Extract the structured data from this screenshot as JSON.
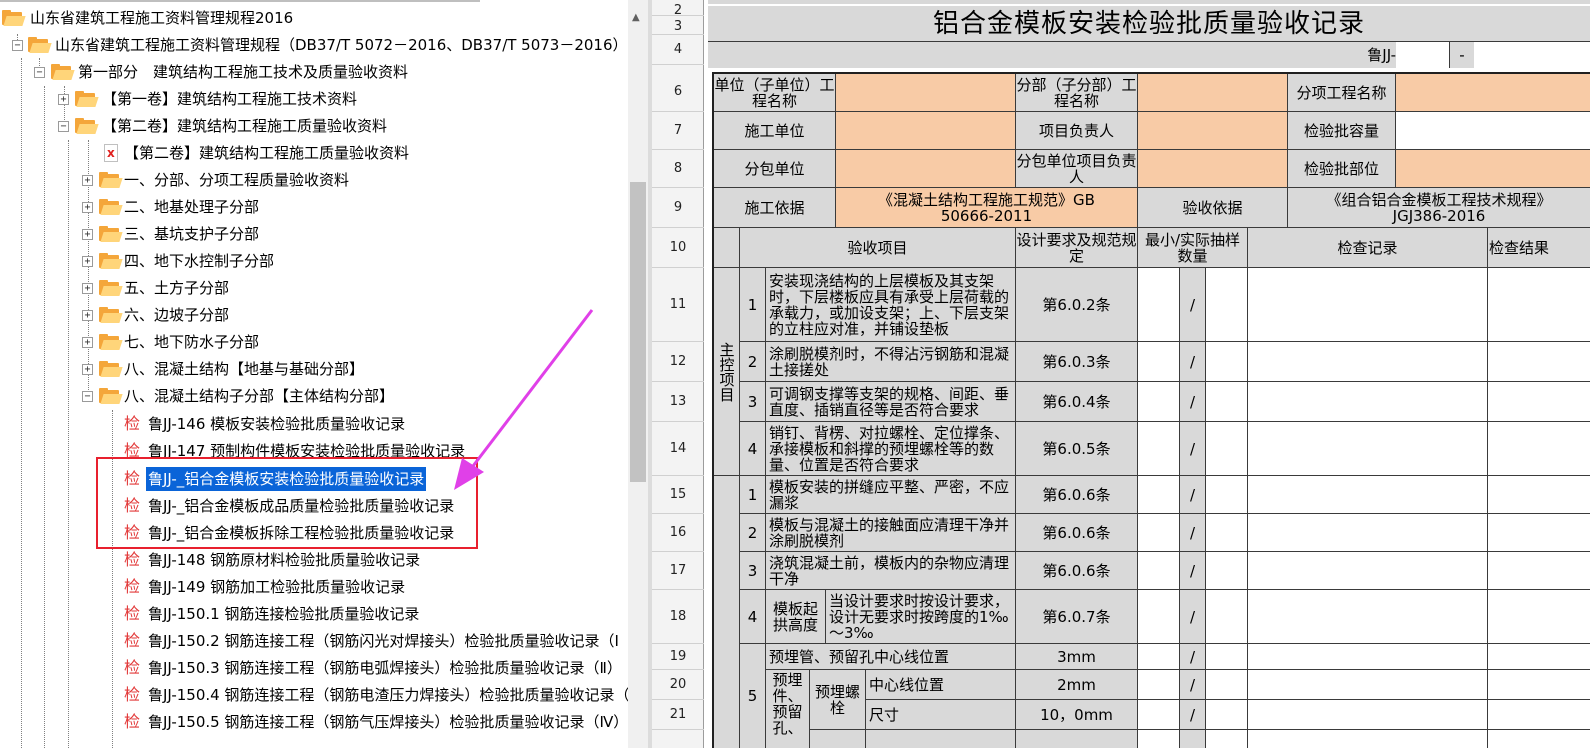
{
  "tree": {
    "items": [
      {
        "label": "山东省建筑工程施工资料管理规程2016"
      },
      {
        "label": "山东省建筑工程施工资料管理规程（DB37/T 5072－2016、DB37/T 5073－2016）"
      },
      {
        "label": "第一部分　建筑结构工程施工技术及质量验收资料"
      },
      {
        "label": "【第一卷】建筑结构工程施工技术资料"
      },
      {
        "label": "【第二卷】建筑结构工程施工质量验收资料"
      },
      {
        "label": "【第二卷】建筑结构工程施工质量验收资料"
      },
      {
        "label": "一、分部、分项工程质量验收资料"
      },
      {
        "label": "二、地基处理子分部"
      },
      {
        "label": "三、基坑支护子分部"
      },
      {
        "label": "四、地下水控制子分部"
      },
      {
        "label": "五、土方子分部"
      },
      {
        "label": "六、边坡子分部"
      },
      {
        "label": "七、地下防水子分部"
      },
      {
        "label": "八、混凝土结构【地基与基础分部】"
      },
      {
        "label": "八、混凝土结构子分部【主体结构分部】"
      },
      {
        "label": "鲁JJ-146 模板安装检验批质量验收记录"
      },
      {
        "label": "鲁JJ-147 预制构件模板安装检验批质量验收记录"
      },
      {
        "label": "鲁JJ-_铝合金模板安装检验批质量验收记录"
      },
      {
        "label": "鲁JJ-_铝合金模板成品质量检验批质量验收记录"
      },
      {
        "label": "鲁JJ-_铝合金模板拆除工程检验批质量验收记录"
      },
      {
        "label": "鲁JJ-148 钢筋原材料检验批质量验收记录"
      },
      {
        "label": "鲁JJ-149 钢筋加工检验批质量验收记录"
      },
      {
        "label": "鲁JJ-150.1 钢筋连接检验批质量验收记录"
      },
      {
        "label": "鲁JJ-150.2 钢筋连接工程（钢筋闪光对焊接头）检验批质量验收记录（Ⅰ"
      },
      {
        "label": "鲁JJ-150.3 钢筋连接工程（钢筋电弧焊接头）检验批质量验收记录（Ⅱ）"
      },
      {
        "label": "鲁JJ-150.4 钢筋连接工程（钢筋电渣压力焊接头）检验批质量验收记录（"
      },
      {
        "label": "鲁JJ-150.5 钢筋连接工程（钢筋气压焊接头）检验批质量验收记录（Ⅳ）"
      }
    ],
    "doc_icon_glyph": "检",
    "expand_plus": "+",
    "expand_minus": "−"
  },
  "sheet": {
    "row_numbers": [
      "2",
      "3",
      "4",
      "6",
      "7",
      "8",
      "9",
      "10",
      "11",
      "12",
      "13",
      "14",
      "15",
      "16",
      "17",
      "18",
      "19",
      "20",
      "21"
    ],
    "title": "铝合金模板安装检验批质量验收记录",
    "code_label": "鲁JJ-",
    "code_dash": "-",
    "header": {
      "unit_name": "单位（子单位）工程名称",
      "subdivision_name": "分部（子分部）工程名称",
      "item_name": "分项工程名称",
      "construction_unit": "施工单位",
      "project_manager": "项目负责人",
      "batch_capacity": "检验批容量",
      "subcontractor": "分包单位",
      "sub_manager": "分包单位项目负责人",
      "batch_location": "检验批部位",
      "construction_basis": "施工依据",
      "construction_basis_value": "《混凝土结构工程施工规范》GB 50666-2011",
      "acceptance_basis": "验收依据",
      "acceptance_basis_value": "《组合铝合金模板工程技术规程》JGJ386-2016"
    },
    "columns": {
      "item": "验收项目",
      "design": "设计要求及规范规定",
      "sample": "最小/实际抽样数量",
      "record": "检查记录",
      "result": "检查结果"
    },
    "main_control_label": "主控项目",
    "slash": "/",
    "main_items": [
      {
        "no": "1",
        "text": "安装现浇结构的上层模板及其支架时，下层楼板应具有承受上层荷载的承载力，或加设支架；上、下层支架的立柱应对准，并铺设垫板",
        "spec": "第6.0.2条"
      },
      {
        "no": "2",
        "text": "涂刷脱模剂时，不得沾污钢筋和混凝土接搓处",
        "spec": "第6.0.3条"
      },
      {
        "no": "3",
        "text": "可调钢支撑等支架的规格、间距、垂直度、插销直径等是否符合要求",
        "spec": "第6.0.4条"
      },
      {
        "no": "4",
        "text": "销钉、背楞、对拉螺栓、定位撑条、承接模板和斜撑的预埋螺栓等的数量、位置是否符合要求",
        "spec": "第6.0.5条"
      }
    ],
    "general_items": [
      {
        "no": "1",
        "text": "模板安装的拼缝应平整、严密，不应漏浆",
        "spec": "第6.0.6条"
      },
      {
        "no": "2",
        "text": "模板与混凝土的接触面应清理干净并涂刷脱模剂",
        "spec": "第6.0.6条"
      },
      {
        "no": "3",
        "text": "浇筑混凝土前，模板内的杂物应清理干净",
        "spec": "第6.0.6条"
      },
      {
        "no": "4",
        "label": "模板起拱高度",
        "text": "当设计要求时按设计要求，设计无要求时按跨度的1‰～3‰",
        "spec": "第6.0.7条"
      }
    ],
    "embedded": {
      "no": "5",
      "group_label": "预埋件、预留孔、",
      "row19_text": "预埋管、预留孔中心线位置",
      "row19_spec": "3mm",
      "bolt_label": "预埋螺栓",
      "row20_text": "中心线位置",
      "row20_spec": "2mm",
      "row21_text": "尺寸",
      "row21_spec": "10，0mm"
    }
  },
  "colors": {
    "peach": "#f8cba6",
    "gray": "#d9d9d9",
    "selection": "#0a64d8",
    "highlight_box": "#e8202e",
    "arrow": "#e040e8"
  }
}
